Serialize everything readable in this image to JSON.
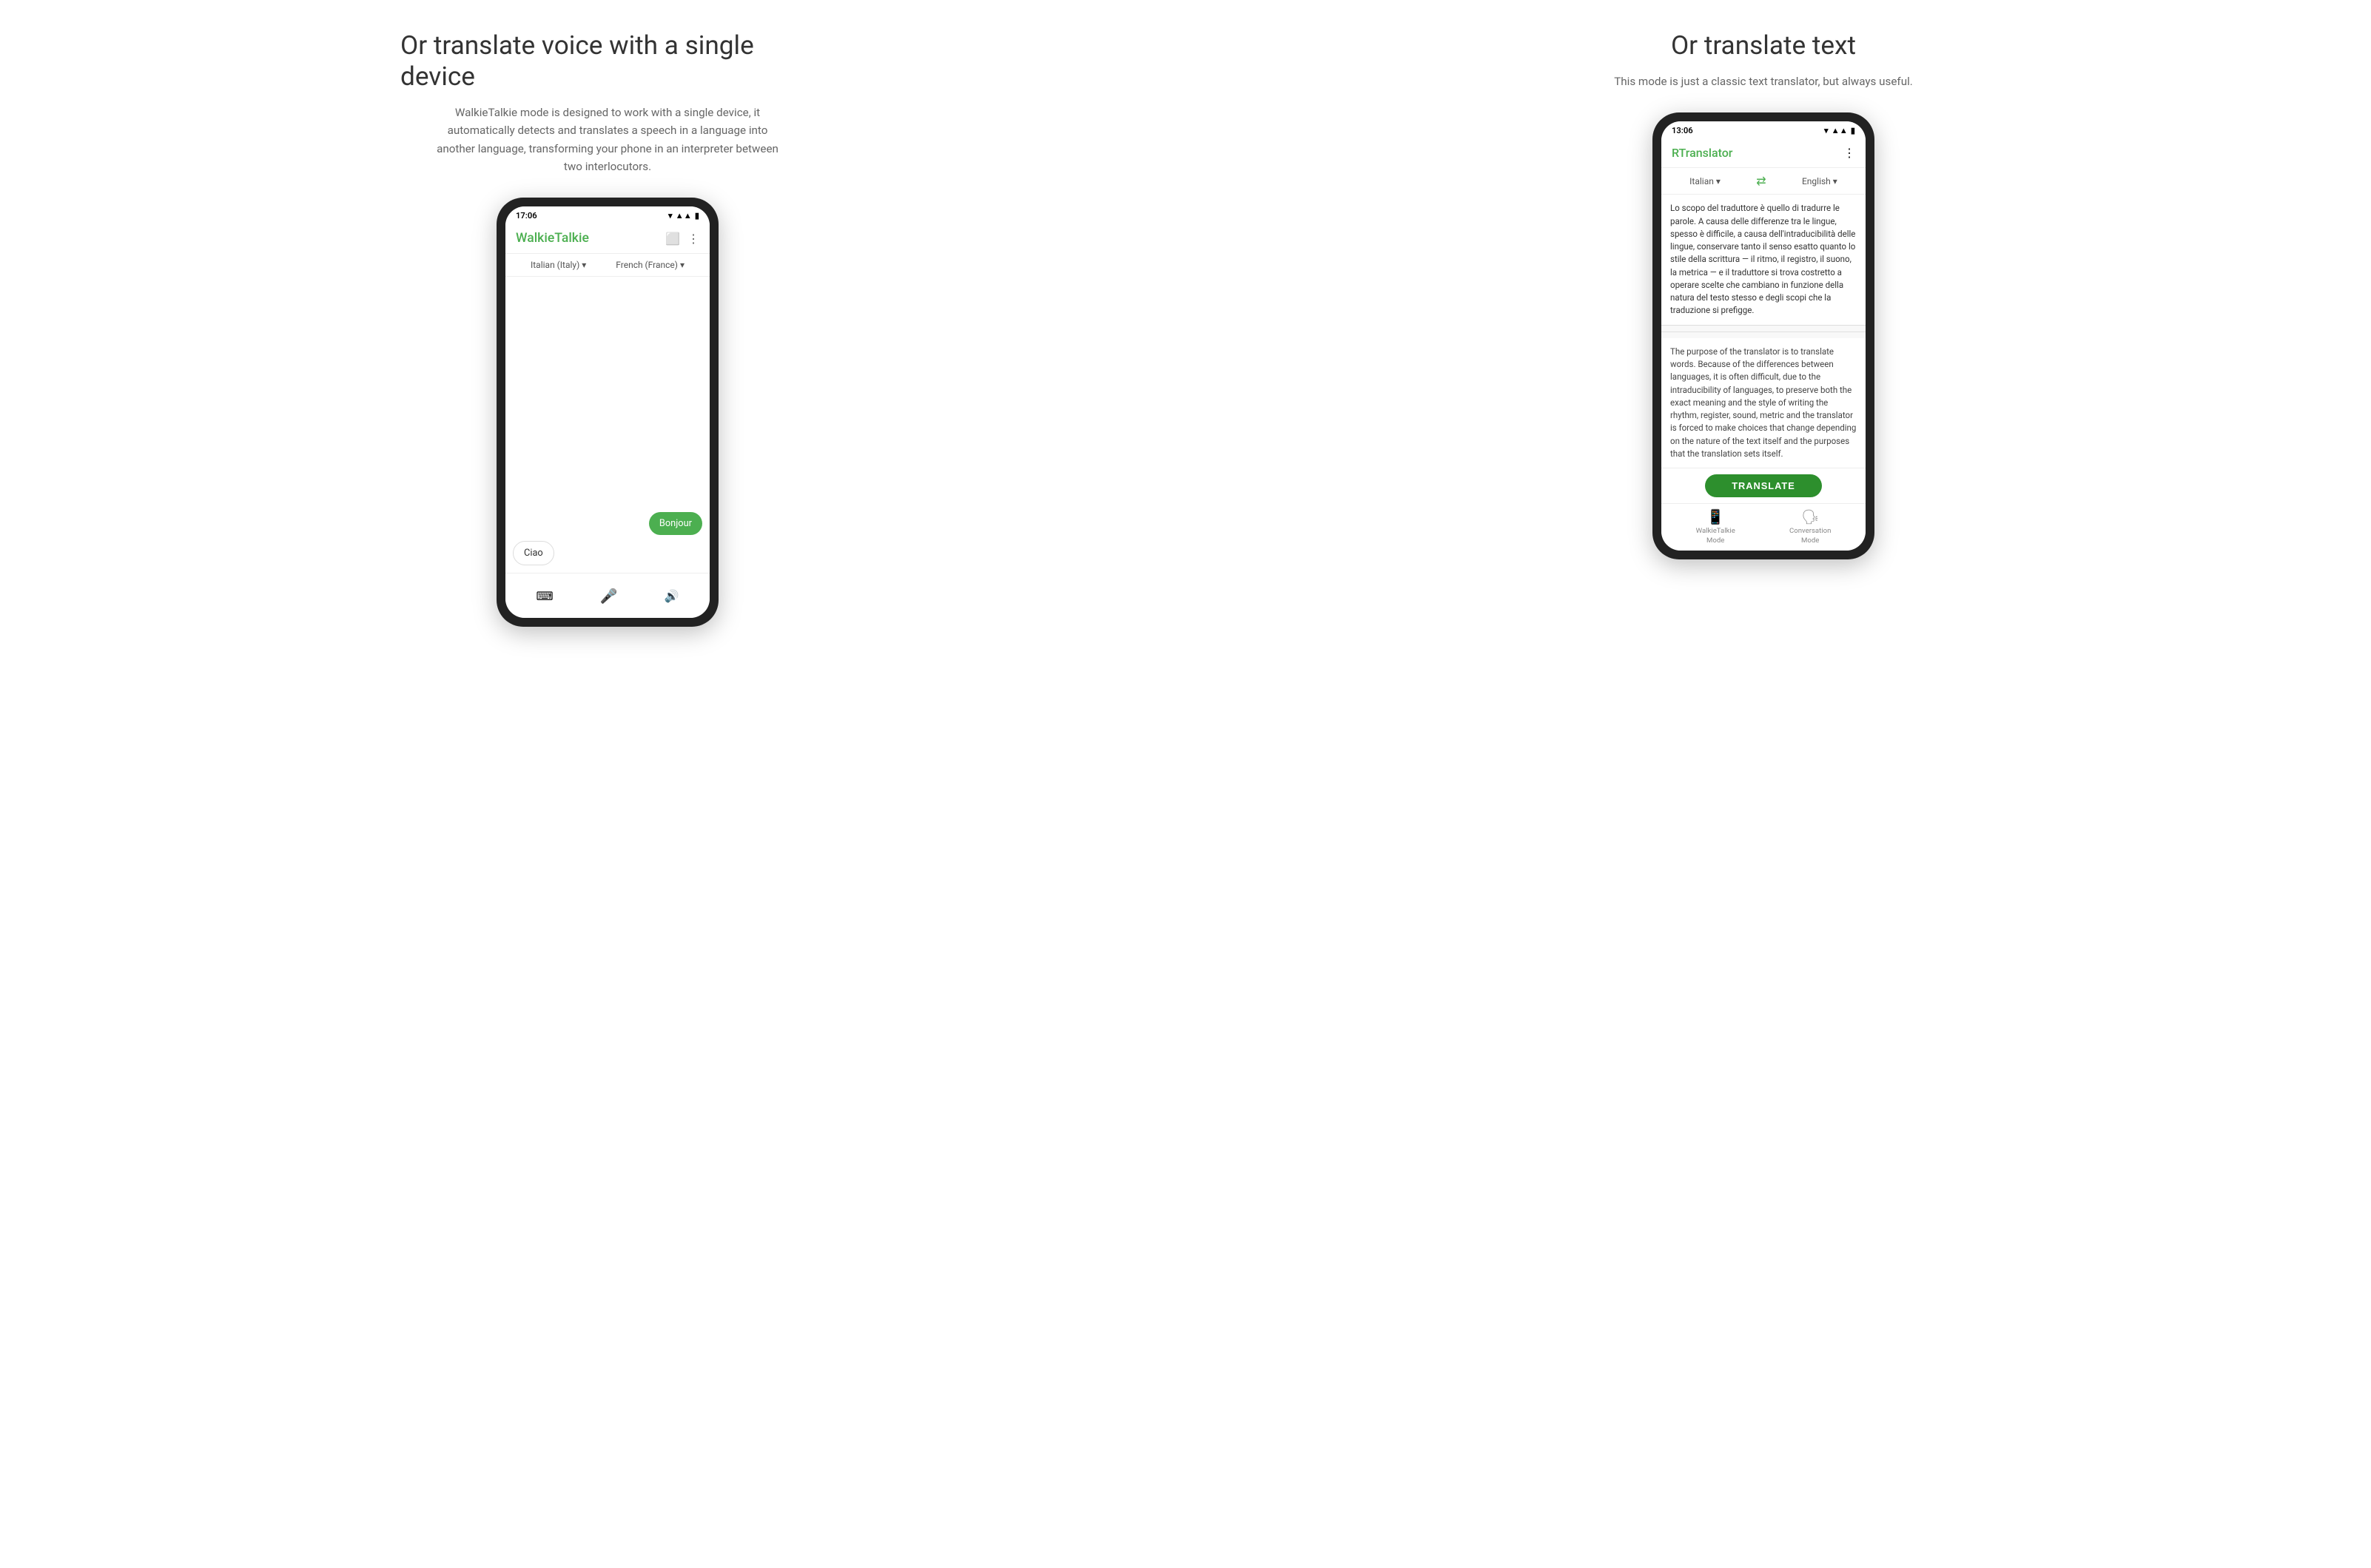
{
  "left": {
    "title": "Or translate voice with a single device",
    "description": "WalkieTalkie mode is designed to work with a single device, it automatically detects and translates a speech in a language into another language, transforming your phone in an interpreter between two interlocutors.",
    "phone": {
      "status_time": "17:06",
      "app_title": "WalkieTalkie",
      "lang_from": "Italian (Italy)",
      "lang_to": "French (France)",
      "bubble_right": "Bonjour",
      "bubble_left": "Ciao"
    }
  },
  "right": {
    "title": "Or translate text",
    "description": "This mode is just a classic text translator, but always useful.",
    "phone": {
      "status_time": "13:06",
      "app_title": "RTranslator",
      "lang_from": "Italian",
      "lang_to": "English",
      "input_text": "Lo scopo del traduttore è quello di tradurre le parole. A causa delle differenze tra le lingue, spesso è difficile, a causa dell'intraducibilità delle lingue, conservare tanto il senso esatto quanto lo stile della scrittura — il ritmo, il registro, il suono, la metrica — e il traduttore si trova costretto a operare scelte che cambiano in funzione della natura del testo stesso e degli scopi che la traduzione si prefigge.",
      "output_text": "The purpose of the translator is to translate words. Because of the differences between languages, it is often difficult, due to the intraducibility of languages, to preserve both the exact meaning and the style of writing  the rhythm, register, sound, metric  and the translator is forced to make choices that change depending on the nature of the text itself and the purposes that the translation sets itself.",
      "translate_button": "TRANSLATE",
      "nav_walkie": "WalkieTalkie\nMode",
      "nav_conversation": "Conversation\nMode"
    }
  }
}
